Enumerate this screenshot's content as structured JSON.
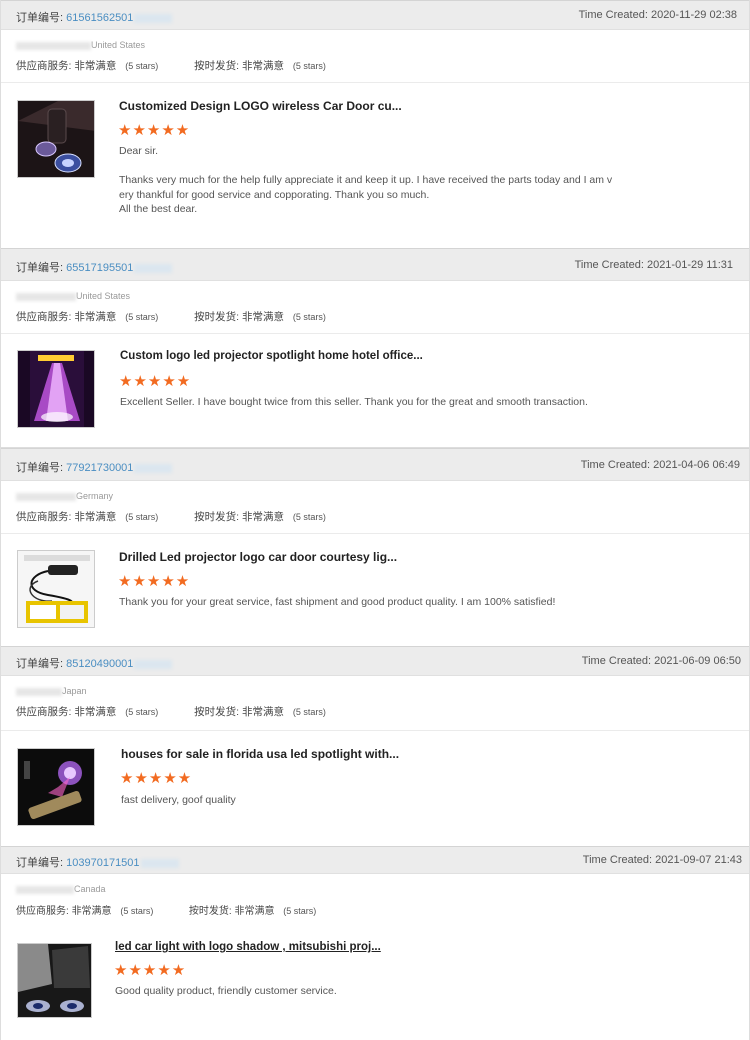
{
  "labels": {
    "order_label": "订单编号:",
    "time_created_label": "Time Created:",
    "supplier_service_label": "供应商服务:",
    "on_time_label": "按时发货:",
    "rating_value": "非常满意",
    "rating_stars": "(5 stars)"
  },
  "reviews": [
    {
      "order_number": "61561562501",
      "time_created": "2020-11-29 02:38",
      "country": "United States",
      "product_title": "Customized Design LOGO wireless Car Door cu...",
      "stars": "★★★★★",
      "feedback": "Dear sir.\n\n   Thanks very much for the help fully appreciate it and keep it up. I have received the parts today and I am v\nery thankful for good service and copporating. Thank you so much.\nAll the best dear."
    },
    {
      "order_number": "65517195501",
      "time_created": "2021-01-29 11:31",
      "country": "United States",
      "product_title": "Custom logo led projector spotlight home hotel office...",
      "stars": "★★★★★",
      "feedback": "Excellent Seller. I have bought twice from this seller. Thank you for the great and smooth transaction."
    },
    {
      "order_number": "77921730001",
      "time_created": "2021-04-06 06:49",
      "country": "Germany",
      "product_title": "Drilled Led projector logo car door courtesy lig...",
      "stars": "★★★★★",
      "feedback": "Thank you for your great service, fast shipment and good product quality. I am 100% satisfied!"
    },
    {
      "order_number": "85120490001",
      "time_created": "2021-06-09 06:50",
      "country": "Japan",
      "product_title": "houses for sale in florida usa led spotlight with...",
      "stars": "★★★★★",
      "feedback": "fast delivery, goof quality"
    },
    {
      "order_number": "103970171501",
      "time_created": "2021-09-07 21:43",
      "country": "Canada",
      "product_title": "led car light with logo shadow , mitsubishi proj...",
      "stars": "★★★★★",
      "feedback": "Good quality product, friendly customer service."
    }
  ],
  "colors": {
    "accent_link": "#4a8ec2",
    "star": "#f26b21",
    "header_bg": "#ececec"
  }
}
